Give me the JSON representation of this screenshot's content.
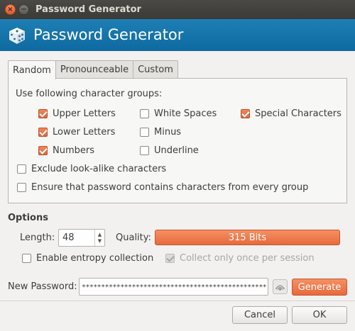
{
  "window": {
    "title": "Password Generator",
    "close_glyph": "×",
    "minimize_glyph": "−"
  },
  "banner": {
    "title": "Password Generator",
    "icon": "dice-icon"
  },
  "tabs": [
    {
      "label": "Random",
      "active": true
    },
    {
      "label": "Pronounceable",
      "active": false
    },
    {
      "label": "Custom",
      "active": false
    }
  ],
  "random_tab": {
    "caption": "Use following character groups:",
    "groups": {
      "upper": {
        "label": "Upper Letters",
        "checked": true
      },
      "lower": {
        "label": "Lower Letters",
        "checked": true
      },
      "numbers": {
        "label": "Numbers",
        "checked": true
      },
      "white_spaces": {
        "label": "White Spaces",
        "checked": false
      },
      "minus": {
        "label": "Minus",
        "checked": false
      },
      "underline": {
        "label": "Underline",
        "checked": false
      },
      "special": {
        "label": "Special Characters",
        "checked": true
      }
    },
    "exclude_lookalike": {
      "label": "Exclude look-alike characters",
      "checked": false
    },
    "ensure_every_group": {
      "label": "Ensure that password contains characters from every group",
      "checked": false
    }
  },
  "options": {
    "caption": "Options",
    "length_label": "Length:",
    "length_value": "48",
    "quality_label": "Quality:",
    "quality_text": "315 Bits",
    "entropy": {
      "label": "Enable entropy collection",
      "checked": false
    },
    "collect_once": {
      "label": "Collect only once per session",
      "checked": true,
      "disabled": true
    }
  },
  "new_password": {
    "label": "New Password:",
    "value": "************************************************",
    "generate_label": "Generate"
  },
  "footer": {
    "cancel_label": "Cancel",
    "ok_label": "OK"
  },
  "colors": {
    "accent": "#e86a3d",
    "banner": "#1579b0",
    "titlebar": "#3b3a36"
  }
}
